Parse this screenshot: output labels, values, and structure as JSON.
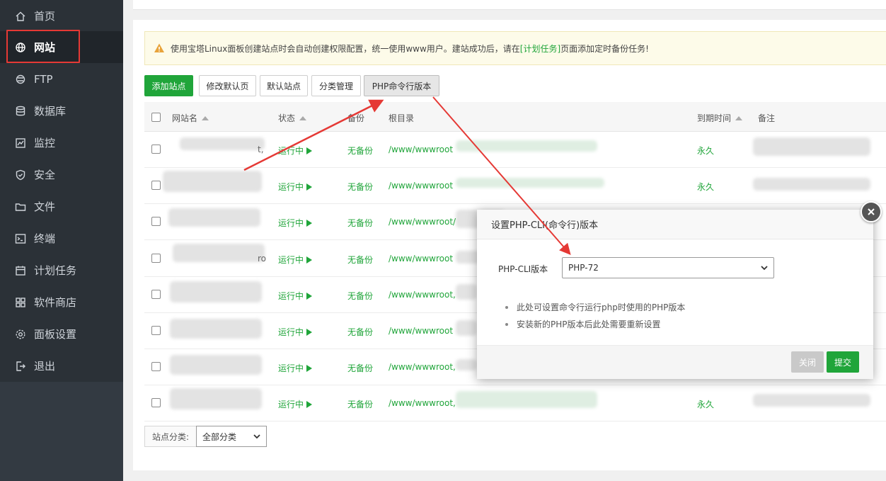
{
  "sidebar": {
    "items": [
      {
        "label": "首页",
        "icon": "home-icon"
      },
      {
        "label": "网站",
        "icon": "globe-icon"
      },
      {
        "label": "FTP",
        "icon": "ftp-icon"
      },
      {
        "label": "数据库",
        "icon": "database-icon"
      },
      {
        "label": "监控",
        "icon": "monitor-icon"
      },
      {
        "label": "安全",
        "icon": "shield-icon"
      },
      {
        "label": "文件",
        "icon": "folder-icon"
      },
      {
        "label": "终端",
        "icon": "terminal-icon"
      },
      {
        "label": "计划任务",
        "icon": "calendar-icon"
      },
      {
        "label": "软件商店",
        "icon": "apps-icon"
      },
      {
        "label": "面板设置",
        "icon": "gear-icon"
      },
      {
        "label": "退出",
        "icon": "logout-icon"
      }
    ],
    "active": "网站"
  },
  "notice": {
    "text_before": "使用宝塔Linux面板创建站点时会自动创建权限配置，统一使用www用户。建站成功后，请在",
    "link": "[计划任务]",
    "text_after": "页面添加定时备份任务!"
  },
  "toolbar": {
    "add_site": "添加站点",
    "edit_default_page": "修改默认页",
    "default_site": "默认站点",
    "category_manage": "分类管理",
    "php_cli_version": "PHP命令行版本"
  },
  "table": {
    "headers": {
      "site_name": "网站名",
      "status": "状态",
      "backup": "备份",
      "root": "根目录",
      "expire": "到期时间",
      "note": "备注"
    },
    "rows": [
      {
        "name_tail": "t,",
        "status": "运行中",
        "backup": "无备份",
        "root": "/www/wwwroot",
        "expire": "永久"
      },
      {
        "name_tail": "",
        "status": "运行中",
        "backup": "无备份",
        "root": "/www/wwwroot",
        "expire": "永久"
      },
      {
        "name_tail": "",
        "status": "运行中",
        "backup": "无备份",
        "root": "/www/wwwroot/",
        "expire": ""
      },
      {
        "name_tail": "ro",
        "status": "运行中",
        "backup": "无备份",
        "root": "/www/wwwroot",
        "expire": ""
      },
      {
        "name_tail": "",
        "status": "运行中",
        "backup": "无备份",
        "root": "/www/wwwroot,",
        "expire": ""
      },
      {
        "name_tail": "",
        "status": "运行中",
        "backup": "无备份",
        "root": "/www/wwwroot",
        "expire": ""
      },
      {
        "name_tail": "",
        "status": "运行中",
        "backup": "无备份",
        "root": "/www/wwwroot,",
        "expire": ""
      },
      {
        "name_tail": "",
        "status": "运行中",
        "backup": "无备份",
        "root": "/www/wwwroot,",
        "expire": "永久"
      }
    ]
  },
  "filter": {
    "label": "站点分类:",
    "selected": "全部分类"
  },
  "modal": {
    "title": "设置PHP-CLI(命令行)版本",
    "field_label": "PHP-CLI版本",
    "selected_version": "PHP-72",
    "tips": [
      "此处可设置命令行运行php时使用的PHP版本",
      "安装新的PHP版本后此处需要重新设置"
    ],
    "close_label": "关闭",
    "submit_label": "提交"
  },
  "colors": {
    "sidebar_bg": "#2b3137",
    "brand_green": "#20a53a",
    "highlight_red": "#e53935"
  }
}
